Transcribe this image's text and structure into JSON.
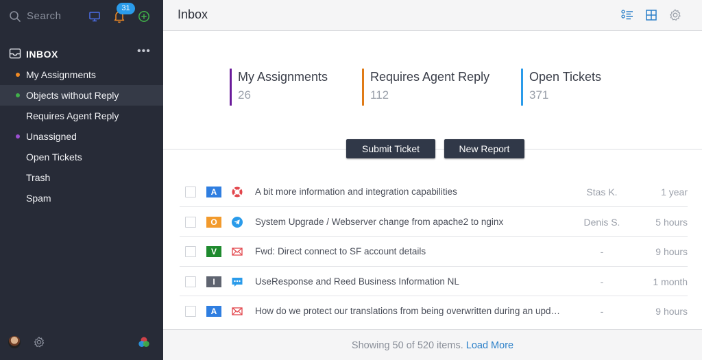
{
  "sidebar": {
    "search_label": "Search",
    "notification_count": "31",
    "inbox_title": "INBOX",
    "more_label": "•••",
    "items": [
      {
        "label": "My Assignments",
        "dot": "#f08a24"
      },
      {
        "label": "Objects without Reply",
        "dot": "#41b04a"
      },
      {
        "label": "Requires Agent Reply",
        "dot": ""
      },
      {
        "label": "Unassigned",
        "dot": "#9b4fd0"
      },
      {
        "label": "Open Tickets",
        "dot": ""
      },
      {
        "label": "Trash",
        "dot": ""
      },
      {
        "label": "Spam",
        "dot": ""
      }
    ],
    "active_index": 1
  },
  "header": {
    "title": "Inbox"
  },
  "stats": [
    {
      "label": "My Assignments",
      "value": "26",
      "color": "#6a1b9a"
    },
    {
      "label": "Requires Agent Reply",
      "value": "112",
      "color": "#e07b17"
    },
    {
      "label": "Open Tickets",
      "value": "371",
      "color": "#2a9bea"
    }
  ],
  "actions": {
    "submit_ticket": "Submit Ticket",
    "new_report": "New Report"
  },
  "rows": [
    {
      "letter": "A",
      "letter_color": "#2f7ee0",
      "channel_icon": "lifebuoy-icon",
      "subject": "A bit more information and integration capabilities",
      "author": "Stas K.",
      "time": "1 year"
    },
    {
      "letter": "O",
      "letter_color": "#f29a2c",
      "channel_icon": "telegram-icon",
      "subject": "System Upgrade / Webserver change from apache2 to nginx",
      "author": "Denis S.",
      "time": "5 hours"
    },
    {
      "letter": "V",
      "letter_color": "#1e8a2e",
      "channel_icon": "email-icon",
      "subject": "Fwd: Direct connect to SF account details",
      "author": "-",
      "time": "9 hours"
    },
    {
      "letter": "I",
      "letter_color": "#5f6470",
      "channel_icon": "chat-icon",
      "subject": "UseResponse and Reed Business Information NL",
      "author": "-",
      "time": "1 month"
    },
    {
      "letter": "A",
      "letter_color": "#2f7ee0",
      "channel_icon": "email-icon",
      "subject": "How do we protect our translations from being overwritten during an update?",
      "author": "-",
      "time": "9 hours"
    }
  ],
  "footer": {
    "showing_text": "Showing 50 of 520 items.",
    "load_more": "Load More"
  },
  "colors": {
    "sidebar_bg": "#272b37",
    "accent": "#2a9bea",
    "button_bg": "#303848"
  }
}
